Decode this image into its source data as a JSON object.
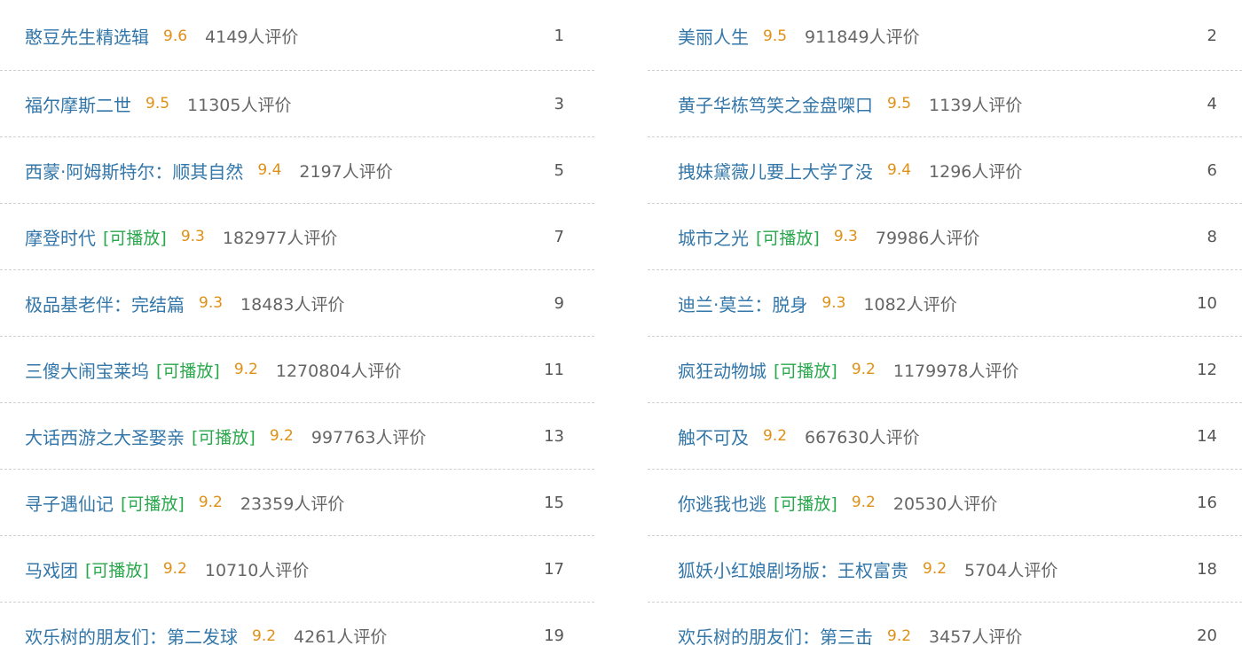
{
  "colors": {
    "title": "#3377aa",
    "playable": "#2aa74c",
    "score": "#e09015",
    "count": "#666666",
    "divider": "#cfcfcf"
  },
  "items": [
    {
      "title": "憨豆先生精选辑",
      "playable": "",
      "score": "9.6",
      "count": "4149人评价",
      "rank": "1"
    },
    {
      "title": "美丽人生",
      "playable": "",
      "score": "9.5",
      "count": "911849人评价",
      "rank": "2"
    },
    {
      "title": "福尔摩斯二世",
      "playable": "",
      "score": "9.5",
      "count": "11305人评价",
      "rank": "3"
    },
    {
      "title": "黄子华栋笃笑之金盘㗎口",
      "playable": "",
      "score": "9.5",
      "count": "1139人评价",
      "rank": "4"
    },
    {
      "title": "西蒙·阿姆斯特尔：顺其自然",
      "playable": "",
      "score": "9.4",
      "count": "2197人评价",
      "rank": "5"
    },
    {
      "title": "拽妹黛薇儿要上大学了没",
      "playable": "",
      "score": "9.4",
      "count": "1296人评价",
      "rank": "6"
    },
    {
      "title": "摩登时代",
      "playable": "[可播放]",
      "score": "9.3",
      "count": "182977人评价",
      "rank": "7"
    },
    {
      "title": "城市之光",
      "playable": "[可播放]",
      "score": "9.3",
      "count": "79986人评价",
      "rank": "8"
    },
    {
      "title": "极品基老伴：完结篇",
      "playable": "",
      "score": "9.3",
      "count": "18483人评价",
      "rank": "9"
    },
    {
      "title": "迪兰·莫兰：脱身",
      "playable": "",
      "score": "9.3",
      "count": "1082人评价",
      "rank": "10"
    },
    {
      "title": "三傻大闹宝莱坞",
      "playable": "[可播放]",
      "score": "9.2",
      "count": "1270804人评价",
      "rank": "11"
    },
    {
      "title": "疯狂动物城",
      "playable": "[可播放]",
      "score": "9.2",
      "count": "1179978人评价",
      "rank": "12"
    },
    {
      "title": "大话西游之大圣娶亲",
      "playable": "[可播放]",
      "score": "9.2",
      "count": "997763人评价",
      "rank": "13"
    },
    {
      "title": "触不可及",
      "playable": "",
      "score": "9.2",
      "count": "667630人评价",
      "rank": "14"
    },
    {
      "title": "寻子遇仙记",
      "playable": "[可播放]",
      "score": "9.2",
      "count": "23359人评价",
      "rank": "15"
    },
    {
      "title": "你逃我也逃",
      "playable": "[可播放]",
      "score": "9.2",
      "count": "20530人评价",
      "rank": "16"
    },
    {
      "title": "马戏团",
      "playable": "[可播放]",
      "score": "9.2",
      "count": "10710人评价",
      "rank": "17"
    },
    {
      "title": "狐妖小红娘剧场版：王权富贵",
      "playable": "",
      "score": "9.2",
      "count": "5704人评价",
      "rank": "18"
    },
    {
      "title": "欢乐树的朋友们：第二发球",
      "playable": "",
      "score": "9.2",
      "count": "4261人评价",
      "rank": "19"
    },
    {
      "title": "欢乐树的朋友们：第三击",
      "playable": "",
      "score": "9.2",
      "count": "3457人评价",
      "rank": "20"
    }
  ]
}
